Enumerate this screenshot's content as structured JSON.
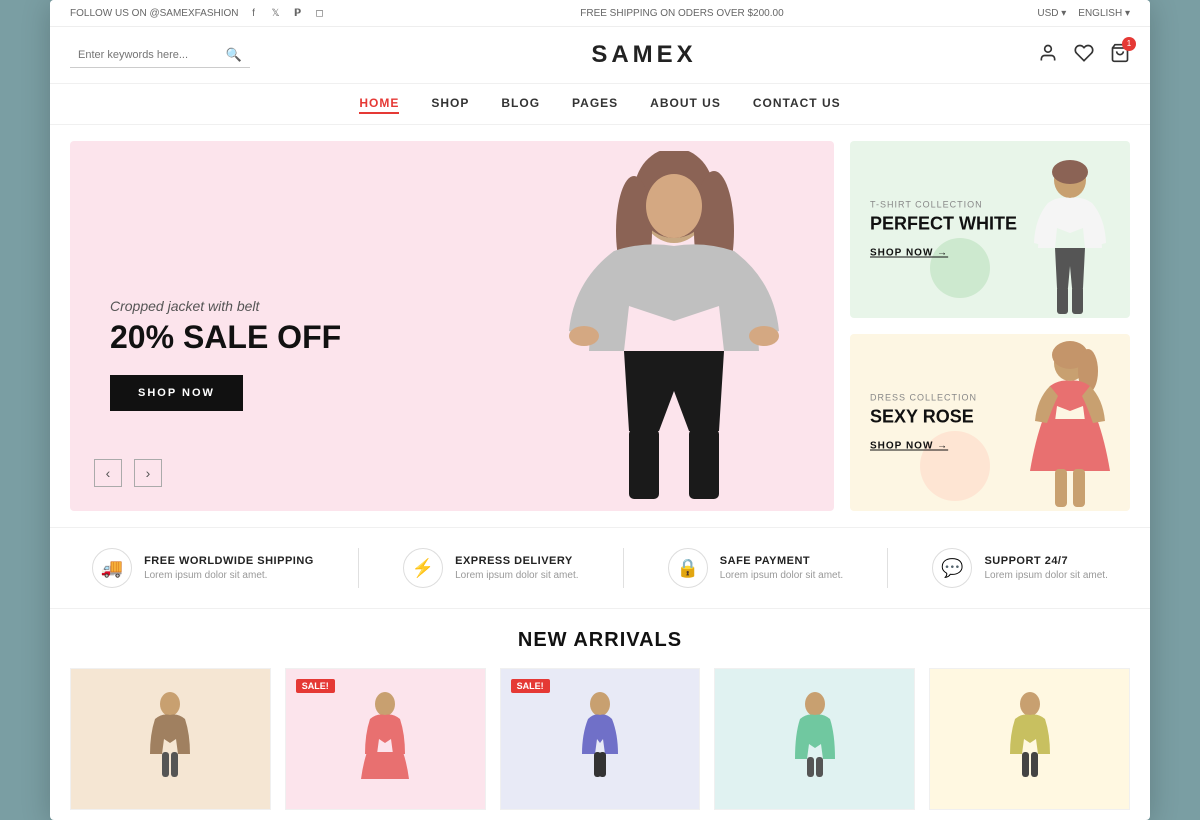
{
  "topbar": {
    "follow_text": "FOLLOW US ON @SAMEXFASHION",
    "shipping_text": "FREE SHIPPING ON ODERS OVER $200.00",
    "currency": "USD ▾",
    "language": "ENGLISH ▾",
    "social_icons": [
      "f",
      "t",
      "p",
      "i"
    ]
  },
  "header": {
    "search_placeholder": "Enter keywords here...",
    "logo": "SAMEX"
  },
  "nav": {
    "items": [
      {
        "label": "HOME",
        "active": true
      },
      {
        "label": "SHOP",
        "active": false
      },
      {
        "label": "BLOG",
        "active": false
      },
      {
        "label": "PAGES",
        "active": false
      },
      {
        "label": "ABOUT US",
        "active": false
      },
      {
        "label": "CONTACT US",
        "active": false
      }
    ]
  },
  "hero": {
    "subtitle": "Cropped jacket with belt",
    "title": "20% SALE OFF",
    "button_label": "SHOP NOW",
    "arrow_prev": "‹",
    "arrow_next": "›"
  },
  "side_banners": [
    {
      "collection_label": "T-SHIRT COLLECTION",
      "title": "PERFECT WHITE",
      "shop_link": "SHOP NOW →"
    },
    {
      "collection_label": "DRESS COLLECTION",
      "title": "SEXY ROSE",
      "shop_link": "SHOP NOW →"
    }
  ],
  "features": [
    {
      "icon": "🚚",
      "title": "FREE WORLDWIDE SHIPPING",
      "desc": "Lorem ipsum dolor sit amet."
    },
    {
      "icon": "⚡",
      "title": "EXPRESS DELIVERY",
      "desc": "Lorem ipsum dolor sit amet."
    },
    {
      "icon": "🔒",
      "title": "SAFE PAYMENT",
      "desc": "Lorem ipsum dolor sit amet."
    },
    {
      "icon": "💬",
      "title": "SUPPORT 24/7",
      "desc": "Lorem ipsum dolor sit amet."
    }
  ],
  "new_arrivals": {
    "section_title": "NEW ARRIVALS",
    "products": [
      {
        "bg": "product-img-1",
        "sale": false
      },
      {
        "bg": "product-img-2",
        "sale": true
      },
      {
        "bg": "product-img-3",
        "sale": true
      },
      {
        "bg": "product-img-4",
        "sale": false
      },
      {
        "bg": "product-img-5",
        "sale": false
      }
    ]
  },
  "cart_badge": "1",
  "sale_label": "SALE!"
}
